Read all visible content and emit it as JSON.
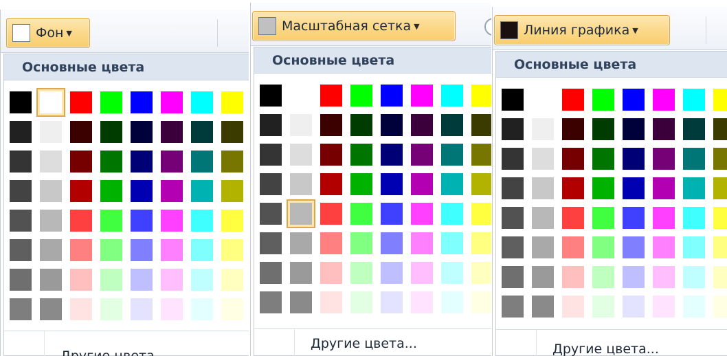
{
  "palette": {
    "rows": [
      [
        "#000000",
        "#ffffff",
        "#ff0000",
        "#00ff00",
        "#0000ff",
        "#ff00ff",
        "#00ffff",
        "#ffff00"
      ],
      [
        "#212121",
        "#efefef",
        "#3b0000",
        "#003b00",
        "#00003b",
        "#3b003b",
        "#003b3b",
        "#3b3b00"
      ],
      [
        "#343434",
        "#dddddd",
        "#760000",
        "#007600",
        "#000076",
        "#760076",
        "#007676",
        "#767600"
      ],
      [
        "#434343",
        "#c8c8c8",
        "#b20000",
        "#00b200",
        "#0000b2",
        "#b200b2",
        "#00b2b2",
        "#b2b200"
      ],
      [
        "#525252",
        "#b8b8b8",
        "#ff4040",
        "#40ff40",
        "#4040ff",
        "#ff40ff",
        "#40ffff",
        "#ffff40"
      ],
      [
        "#5f5f5f",
        "#a9a9a9",
        "#ff8080",
        "#80ff80",
        "#8080ff",
        "#ff80ff",
        "#80ffff",
        "#ffff80"
      ],
      [
        "#6f6f6f",
        "#9a9a9a",
        "#ffbfbf",
        "#bfffbf",
        "#bfbfff",
        "#ffbfff",
        "#bfffff",
        "#ffffbf"
      ],
      [
        "#7e7e7e",
        "#8a8a8a",
        "#ffe3e3",
        "#e3ffe3",
        "#e3e3ff",
        "#ffe3ff",
        "#e3ffff",
        "#ffffe3"
      ]
    ]
  },
  "panels": [
    {
      "button_label": "Фон",
      "current_color": "#ffffff",
      "selected_cell": [
        0,
        1
      ],
      "section_title": "Основные цвета",
      "more_colors": "Другие цвета..."
    },
    {
      "button_label": "Масштабная сетка",
      "current_color": "#c0c0c0",
      "selected_cell": [
        4,
        1
      ],
      "section_title": "Основные цвета",
      "more_colors": "Другие цвета..."
    },
    {
      "button_label": "Линия графика",
      "current_color": "#1a1010",
      "selected_cell": null,
      "section_title": "Основные цвета",
      "more_colors": "Другие цвета..."
    }
  ]
}
